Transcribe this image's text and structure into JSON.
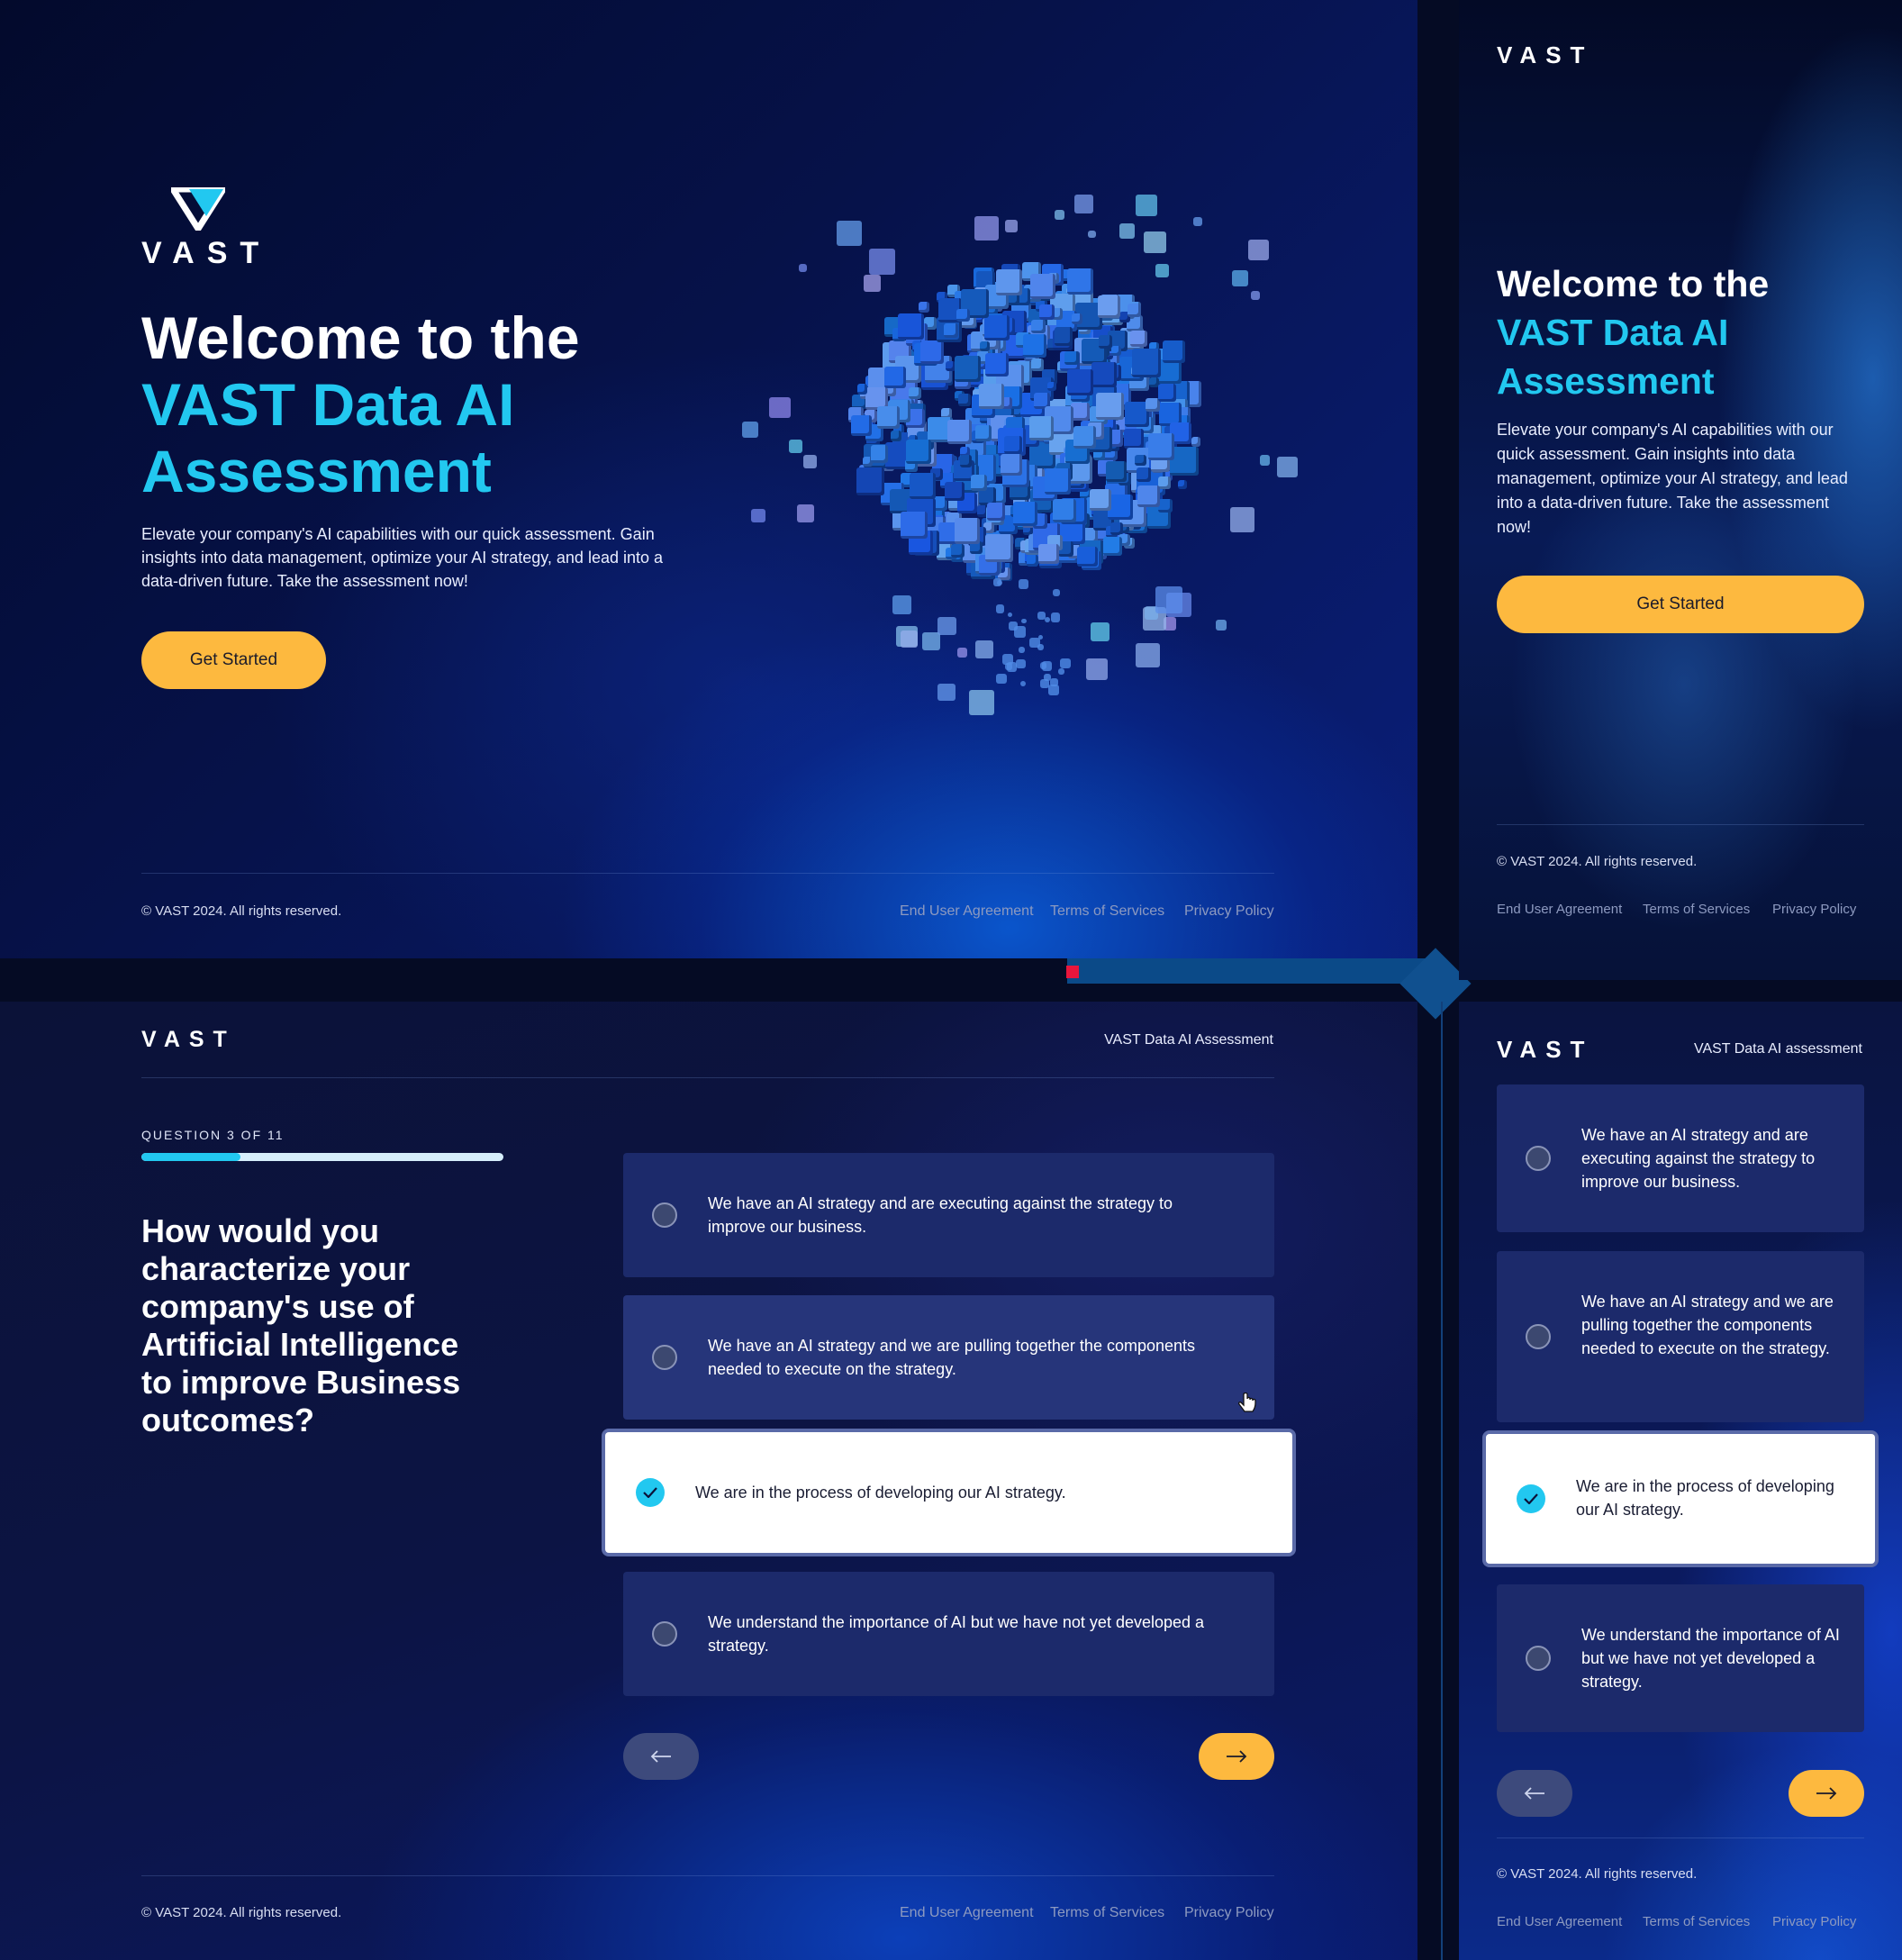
{
  "brand": {
    "wordmark": "VAST"
  },
  "welcome": {
    "title_line1": "Welcome to the",
    "title_line2": "VAST Data AI",
    "title_line3": "Assessment",
    "description": "Elevate your company's AI capabilities with our quick assessment. Gain insights into data management, optimize your AI strategy, and lead into a data-driven future. Take the assessment now!",
    "cta": "Get Started"
  },
  "header": {
    "title_desktop": "VAST Data AI Assessment",
    "title_mobile": "VAST Data AI assessment"
  },
  "question": {
    "counter": "QUESTION 3 OF 11",
    "progress_fraction": 0.2727,
    "text": "How would you characterize your company's use of Artificial Intelligence to improve Business outcomes?",
    "options": [
      {
        "label": "We have an AI strategy and are executing against the strategy to improve our business.",
        "selected": false
      },
      {
        "label": "We have an AI strategy and we are pulling together the components needed to execute on the strategy.",
        "selected": false
      },
      {
        "label": "We are in the process of developing our AI strategy.",
        "selected": true
      },
      {
        "label": "We understand the importance of AI but we have not yet developed a strategy.",
        "selected": false
      }
    ],
    "back_icon": "arrow-left-icon",
    "next_icon": "arrow-right-icon"
  },
  "footer": {
    "copyright": "© VAST 2024. All rights reserved.",
    "links": [
      "End User Agreement",
      "Terms of Services",
      "Privacy Policy"
    ]
  },
  "colors": {
    "accent_cyan": "#22c8f0",
    "cta_yellow": "#fdb93f",
    "background_navy": "#050b24",
    "option_card": "#1c2a6b"
  }
}
